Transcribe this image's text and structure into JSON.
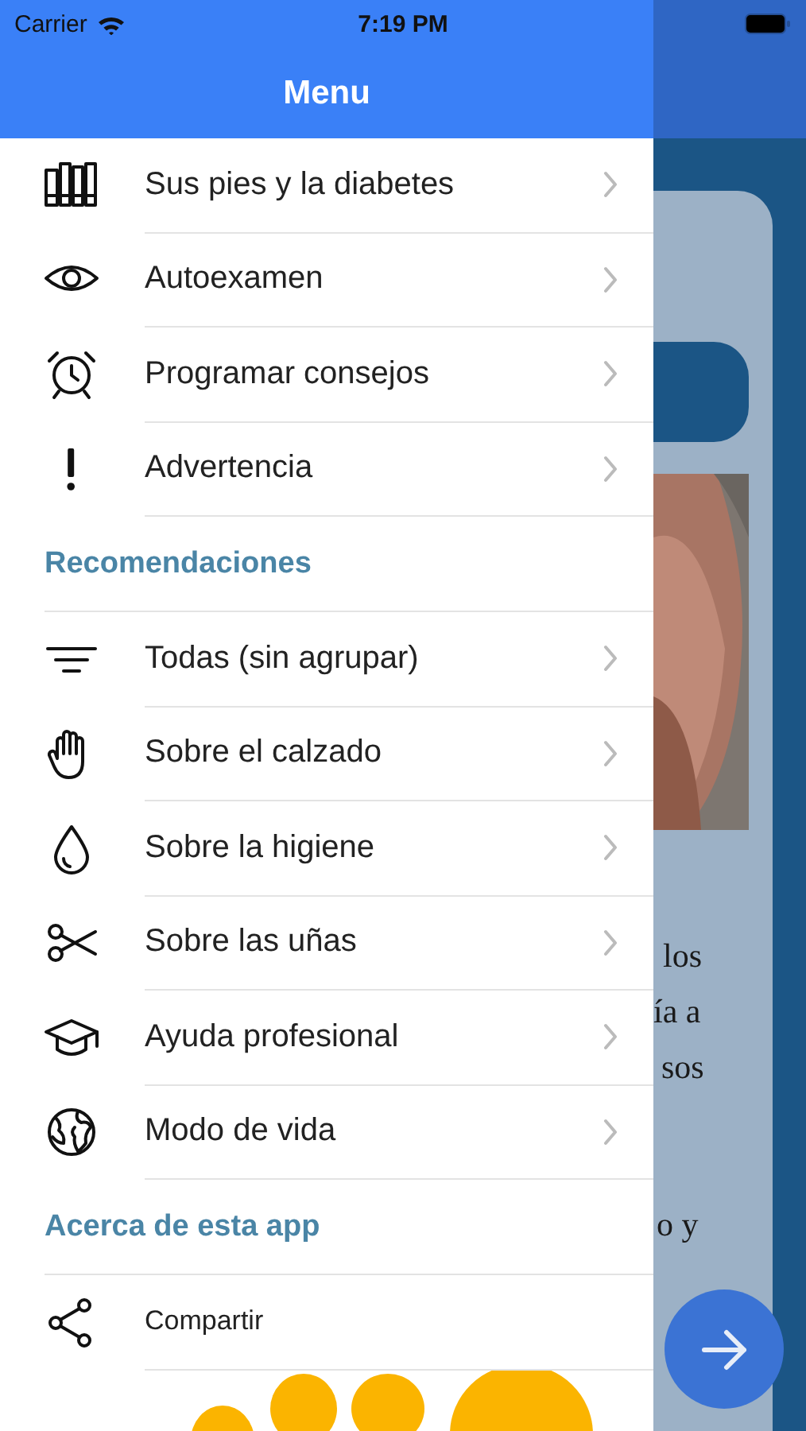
{
  "status_bar": {
    "carrier": "Carrier",
    "time": "7:19 PM"
  },
  "menu": {
    "title": "Menu",
    "sections": [
      {
        "items": [
          {
            "label": "Sus pies y la diabetes",
            "kind": "link"
          },
          {
            "label": "Autoexamen",
            "kind": "link"
          },
          {
            "label": "Programar consejos",
            "kind": "link"
          },
          {
            "label": "Advertencia",
            "kind": "link"
          }
        ]
      },
      {
        "title": "Recomendaciones",
        "items": [
          {
            "label": "Todas (sin agrupar)",
            "kind": "link"
          },
          {
            "label": "Sobre el calzado",
            "kind": "link"
          },
          {
            "label": "Sobre la higiene",
            "kind": "link"
          },
          {
            "label": "Sobre las uñas",
            "kind": "link"
          },
          {
            "label": "Ayuda profesional",
            "kind": "link"
          },
          {
            "label": "Modo de vida",
            "kind": "link"
          }
        ]
      },
      {
        "title": "Acerca de esta app",
        "items": [
          {
            "label": "Compartir",
            "kind": "action"
          }
        ]
      }
    ]
  },
  "background_page": {
    "text_lines": [
      "los",
      "ía a",
      "sos",
      "o y"
    ]
  }
}
